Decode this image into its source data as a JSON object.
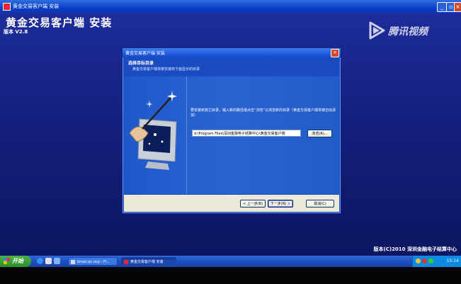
{
  "outer_window": {
    "title": "黄金交易客户端 安装",
    "controls": [
      "minimize",
      "restore",
      "close"
    ]
  },
  "installer": {
    "app_title": "黄金交易客户端 安装",
    "version": "版本 V2.8",
    "copyright": "版本(C)2010 深圳金融电子结算中心"
  },
  "watermark": {
    "text": "腾讯视频"
  },
  "dialog": {
    "title": "黄金交易客户端 安装",
    "heading": "选择目标目录",
    "subheading": "黄金交易客户端将被安装到下面显示的目录",
    "instructions": "要安装到其它目录，输入新的路径或点击“浏览”以浏览新的目录（黄金交易客户端将被自动添加）",
    "path_value": "d:\\Program Files\\深圳金融电子结算中心\\黄金交易客户端",
    "browse_label": "浏览(R)...",
    "back_label": "< 上一步(B)",
    "next_label": "下一步(N) >",
    "cancel_label": "取消(C)"
  },
  "taskbar": {
    "start_label": "开始",
    "quick_launch": [
      "ie-icon",
      "media-icon",
      "desktop-icon"
    ],
    "tasks": [
      {
        "label": "bmail.pc.ocp - Fi..."
      },
      {
        "label": "黄金交易客户端 安装"
      }
    ],
    "clock": "15:14"
  },
  "colors": {
    "installer_bg": "#14207d",
    "dialog_bg": "#1c53c4",
    "taskbar": "#1d4fc0",
    "start_green": "#3a9d39"
  }
}
